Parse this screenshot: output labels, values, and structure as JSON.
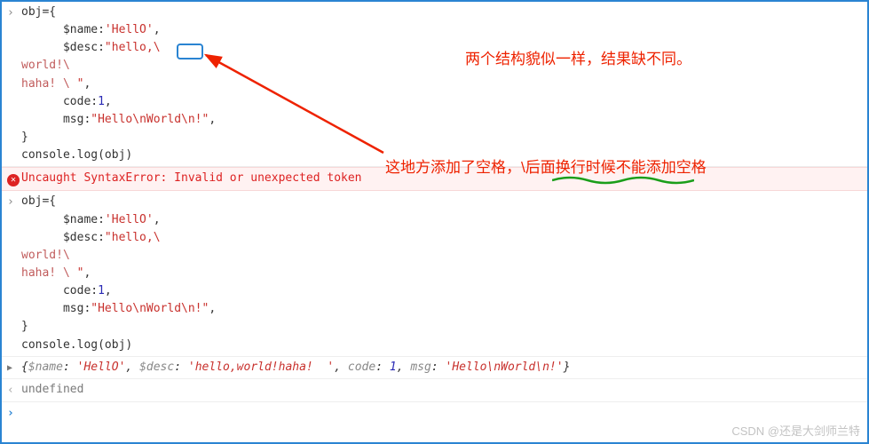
{
  "block1": {
    "line1": "obj={",
    "line2_pre": "      $name:",
    "line2_str": "'HellO'",
    "line2_post": ",",
    "line3_pre": "      $desc:",
    "line3_str": "\"hello,\\ ",
    "line4": "world!\\",
    "line5_pre": "haha! \\ ",
    "line5_str": "\"",
    "line5_post": ",",
    "line6_pre": "      code:",
    "line6_num": "1",
    "line6_post": ",",
    "line7_pre": "      msg:",
    "line7_str": "\"Hello\\nWorld\\n!\"",
    "line7_post": ",",
    "line8": "}",
    "line9": "console.log(obj)"
  },
  "error": "Uncaught SyntaxError: Invalid or unexpected token",
  "block2": {
    "line1": "obj={",
    "line2_pre": "      $name:",
    "line2_str": "'HellO'",
    "line2_post": ",",
    "line3_pre": "      $desc:",
    "line3_str": "\"hello,\\",
    "line4": "world!\\",
    "line5_pre": "haha! \\ ",
    "line5_str": "\"",
    "line5_post": ",",
    "line6_pre": "      code:",
    "line6_num": "1",
    "line6_post": ",",
    "line7_pre": "      msg:",
    "line7_str": "\"Hello\\nWorld\\n!\"",
    "line7_post": ",",
    "line8": "}",
    "line9": "console.log(obj)"
  },
  "result": {
    "open": "{",
    "k1": "$name",
    "v1": "'HellO'",
    "k2": "$desc",
    "v2": "'hello,world!haha!  '",
    "k3": "code",
    "v3": "1",
    "k4": "msg",
    "v4": "'Hello\\nWorld\\n!'",
    "close": "}"
  },
  "undefined_text": "undefined",
  "annot1": "两个结构貌似一样，结果缺不同。",
  "annot2": "这地方添加了空格，\\后面换行时候不能添加空格",
  "watermark": "CSDN @还是大剑师兰特",
  "prompt_in": "›",
  "prompt_out": "‹",
  "expand": "▶",
  "cursor": "›"
}
